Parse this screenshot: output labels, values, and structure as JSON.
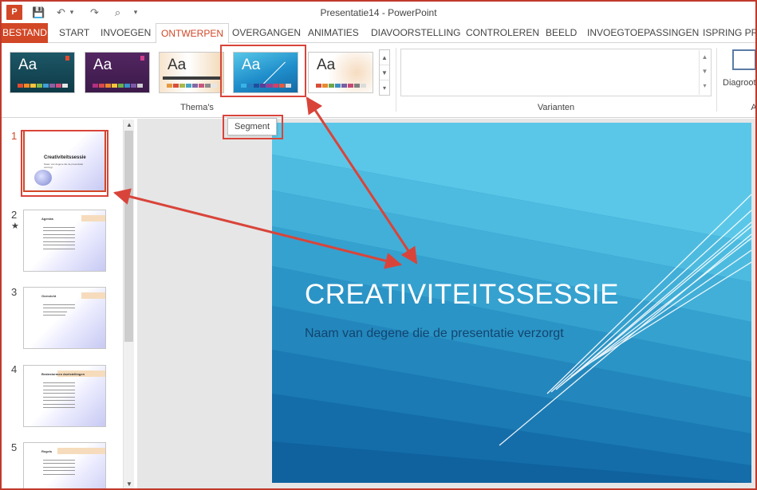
{
  "window": {
    "title": "Presentatie14 - PowerPoint"
  },
  "qat": {
    "logo": "P",
    "save": "💾",
    "undo": "↶",
    "undo_drop": "▾",
    "redo": "↷",
    "present": "⌕",
    "more": "▾"
  },
  "tabs": [
    {
      "label": "BESTAND"
    },
    {
      "label": "START"
    },
    {
      "label": "INVOEGEN"
    },
    {
      "label": "ONTWERPEN"
    },
    {
      "label": "OVERGANGEN"
    },
    {
      "label": "ANIMATIES"
    },
    {
      "label": "DIAVOORSTELLING"
    },
    {
      "label": "CONTROLEREN"
    },
    {
      "label": "BEELD"
    },
    {
      "label": "INVOEGTOEPASSINGEN"
    },
    {
      "label": "ISPRING PRES"
    }
  ],
  "ribbon": {
    "themes_label": "Thema's",
    "variants_label": "Varianten",
    "diagram_label": "Diagroot",
    "cut_label": "A",
    "theme_sample": "Aa",
    "themes": [
      {
        "name": "theme-1",
        "colors": [
          "#1c4f5c",
          "#e34a2f"
        ]
      },
      {
        "name": "theme-2",
        "colors": [
          "#4a2158",
          "#b22f82"
        ]
      },
      {
        "name": "theme-3",
        "colors": [
          "#f6e3cb",
          "#e69a3e"
        ]
      },
      {
        "name": "theme-segment",
        "colors": [
          "#1f8ecb",
          "#57c7e8"
        ]
      },
      {
        "name": "theme-5",
        "colors": [
          "#ffffff",
          "#e8e8e8"
        ]
      }
    ]
  },
  "tooltip": {
    "text": "Segment"
  },
  "slides_pane": {
    "numbers": [
      "1",
      "2",
      "3",
      "4",
      "5"
    ],
    "star": "★",
    "slides": [
      {
        "title": "Creativiteitssessie",
        "subtitle": "Naam van degene die de presentatie verzorgt"
      },
      {
        "title": "Agenda"
      },
      {
        "title": "Overzicht"
      },
      {
        "title": "Brainstormen doelstellingen"
      },
      {
        "title": "Regels"
      }
    ]
  },
  "slide": {
    "title": "CREATIVITEITSSESSIE",
    "subtitle": "Naam van degene die de presentatie verzorgt"
  },
  "colors": {
    "accent": "#d24726",
    "highlight": "#d9443a",
    "slide_light": "#5bc8e8",
    "slide_dark": "#0c5b94"
  }
}
